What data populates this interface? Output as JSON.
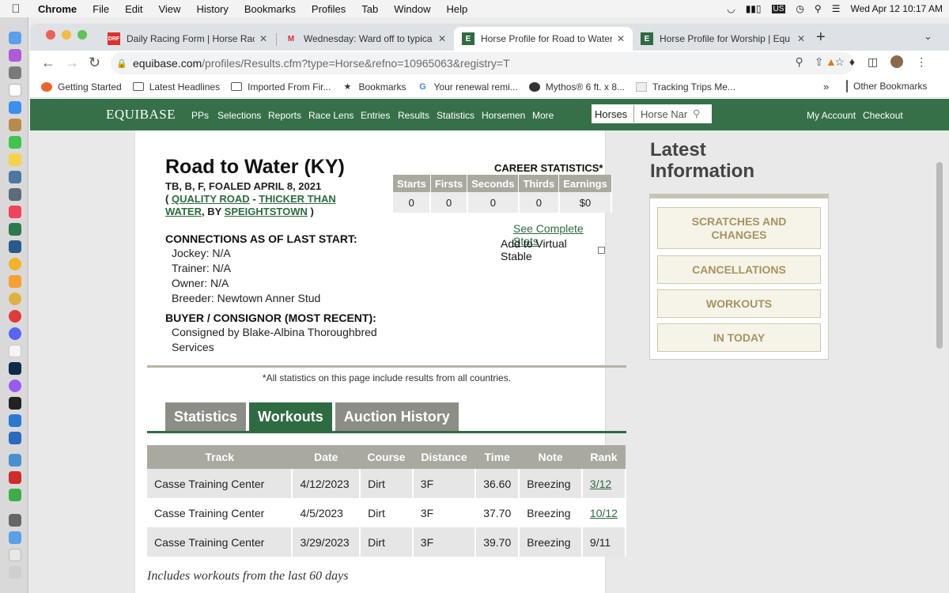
{
  "menubar": {
    "app": "Chrome",
    "items": [
      "File",
      "Edit",
      "View",
      "History",
      "Bookmarks",
      "Profiles",
      "Tab",
      "Window",
      "Help"
    ],
    "datetime": "Wed Apr 12  10:17 AM",
    "keyboard": "US"
  },
  "tabs": [
    {
      "title": "Daily Racing Form | Horse Raci",
      "favicon": "DRF"
    },
    {
      "title": "Wednesday: Ward off to typica",
      "favicon": "M"
    },
    {
      "title": "Horse Profile for Road to Water",
      "favicon": "E"
    },
    {
      "title": "Horse Profile for Worship | Equ",
      "favicon": "E"
    }
  ],
  "url": {
    "host": "equibase.com",
    "path": "/profiles/Results.cfm?type=Horse&refno=10965063&registry=T"
  },
  "bookmarks": [
    {
      "label": "Getting Started",
      "icon": "firefox-icon"
    },
    {
      "label": "Latest Headlines",
      "icon": "folder-icon"
    },
    {
      "label": "Imported From Fir...",
      "icon": "folder-icon"
    },
    {
      "label": "Bookmarks",
      "icon": "star-icon"
    },
    {
      "label": "Your renewal remi...",
      "icon": "google-icon"
    },
    {
      "label": "Mythos® 6 ft. x 8...",
      "icon": "mythos-icon"
    },
    {
      "label": "Tracking Trips Me...",
      "icon": "page-icon"
    }
  ],
  "bookmarks_more": "»",
  "bookmarks_other": "Other Bookmarks",
  "site": {
    "logo": "EQUIBASE",
    "nav": [
      "PPs",
      "Selections",
      "Reports",
      "Race Lens",
      "Entries",
      "Results",
      "Statistics",
      "Horsemen",
      "More"
    ],
    "search_select": "Horses",
    "search_placeholder": "Horse Nar",
    "account": "My Account",
    "checkout": "Checkout"
  },
  "horse": {
    "name": "Road to Water (KY)",
    "line1": "TB, B, F, FOALED APRIL 8, 2021",
    "open_paren": "(",
    "sire": "QUALITY ROAD",
    "dash": "-",
    "dam": "THICKER THAN WATER",
    "by": ", BY",
    "damsire": "SPEIGHTSTOWN",
    "close_paren": ")"
  },
  "connections": {
    "title": "CONNECTIONS AS OF LAST START:",
    "jockey": "Jockey: N/A",
    "trainer": "Trainer: N/A",
    "owner": "Owner: N/A",
    "breeder": "Breeder: Newtown Anner Stud"
  },
  "buyer": {
    "title": "BUYER / CONSIGNOR (MOST RECENT):",
    "line1": "Consigned by Blake-Albina Thoroughbred",
    "line2": "Services"
  },
  "career": {
    "title": "CAREER STATISTICS*",
    "headers": [
      "Starts",
      "Firsts",
      "Seconds",
      "Thirds",
      "Earnings"
    ],
    "values": [
      "0",
      "0",
      "0",
      "0",
      "$0"
    ],
    "complete_link": "See Complete Stats",
    "virtual_stable": "Add to Virtual Stable"
  },
  "note": "*All statistics on this page include results from all countries.",
  "stat_tabs": [
    "Statistics",
    "Workouts",
    "Auction History"
  ],
  "workouts": {
    "headers": [
      "Track",
      "Date",
      "Course",
      "Distance",
      "Time",
      "Note",
      "Rank"
    ],
    "rows": [
      [
        "Casse Training Center",
        "4/12/2023",
        "Dirt",
        "3F",
        "36.60",
        "Breezing",
        "3/12"
      ],
      [
        "Casse Training Center",
        "4/5/2023",
        "Dirt",
        "3F",
        "37.70",
        "Breezing",
        "10/12"
      ],
      [
        "Casse Training Center",
        "3/29/2023",
        "Dirt",
        "3F",
        "39.70",
        "Breezing",
        "9/11"
      ]
    ],
    "footnote": "Includes workouts from the last 60 days"
  },
  "sidebar": {
    "title_line1": "Latest",
    "title_line2": "Information",
    "buttons": [
      "SCRATCHES AND CHANGES",
      "CANCELLATIONS",
      "WORKOUTS",
      "IN TODAY"
    ]
  }
}
